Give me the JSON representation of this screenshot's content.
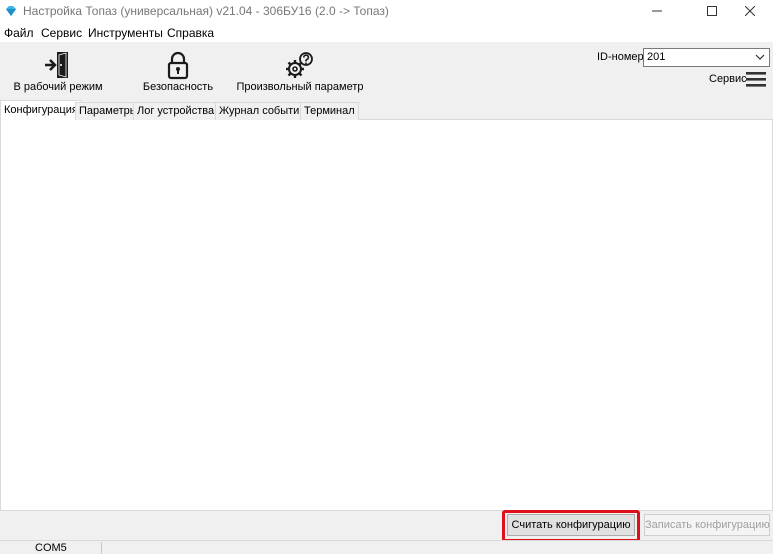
{
  "window": {
    "title": "Настройка Топаз (универсальная) v21.04 - 306БУ16 (2.0 -> Топаз)",
    "icon": "diamond-icon",
    "accent_color": "#2aa8e0"
  },
  "menu": {
    "items": [
      {
        "label": "Файл"
      },
      {
        "label": "Сервис"
      },
      {
        "label": "Инструменты"
      },
      {
        "label": "Справка"
      }
    ]
  },
  "toolbar": {
    "work_mode": {
      "label": "В рабочий режим",
      "icon": "exit-door-icon"
    },
    "security": {
      "label": "Безопасность",
      "icon": "lock-icon"
    },
    "custom_param": {
      "label": "Произвольный параметр",
      "icon": "gears-question-icon"
    },
    "id_label": "ID-номер",
    "id_value": "201",
    "service_label": "Сервис",
    "service_icon": "hamburger-menu-icon"
  },
  "tabs": [
    {
      "label": "Конфигурация",
      "active": true
    },
    {
      "label": "Параметры",
      "active": false
    },
    {
      "label": "Лог устройства",
      "active": false
    },
    {
      "label": "Журнал событий",
      "active": false
    },
    {
      "label": "Терминал",
      "active": false
    }
  ],
  "actions": {
    "read_label": "Считать конфигурацию",
    "write_label": "Записать конфигурацию",
    "write_enabled": false,
    "highlight_color": "#e0101a"
  },
  "status": {
    "port": "COM5"
  }
}
